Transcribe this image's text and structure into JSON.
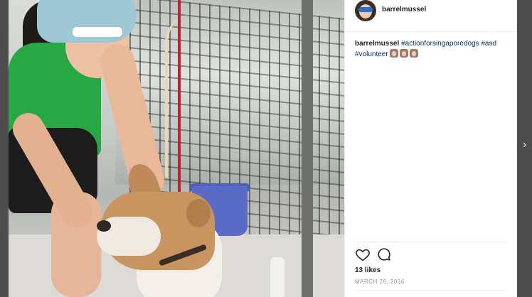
{
  "post": {
    "username": "barrelmussel",
    "caption": {
      "user": "barrelmussel",
      "hashtag_1": "#actionforsingaporedogs",
      "hashtag_2": "#asd",
      "hashtag_3": "#volunteer",
      "emoji_count": 3
    },
    "likes": "13 likes",
    "date": "MARCH 26, 2016"
  },
  "icons": {
    "like": "heart-icon",
    "comment": "comment-icon",
    "next": "chevron-right-icon"
  },
  "colors": {
    "link": "#003569",
    "text": "#262626",
    "muted": "#999999",
    "overlay": "#4d4d4d"
  }
}
